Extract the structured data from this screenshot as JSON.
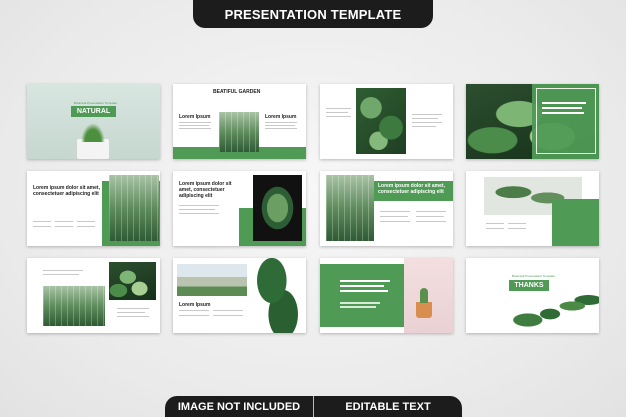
{
  "header": {
    "title": "PRESENTATION TEMPLATE"
  },
  "footer": {
    "left_label": "IMAGE NOT INCLUDED",
    "right_label": "EDITABLE TEXT"
  },
  "slides": {
    "s1": {
      "small": "Botanical Presentation Template",
      "label": "NATURAL"
    },
    "s2": {
      "title": "BEATIFUL GARDEN",
      "left_head": "Lorem Ipsum",
      "right_head": "Lorem Ipsum"
    },
    "s5": {
      "head": "Lorem ipsum dolor sit amet, consectetuer adipiscing elit"
    },
    "s6": {
      "head": "Lorem ipsum dolor sit amet, consectetuer adipiscing elit"
    },
    "s8": {
      "head": "Lorem ipsum dolor sit amet, consectetuer adipiscing elit"
    },
    "s12": {
      "small": "Botanical Presentation Template",
      "label": "THANKS"
    },
    "s13": {
      "head": "Lorem Ipsum"
    }
  },
  "colors": {
    "accent": "#4f9a55",
    "banner": "#1c1c1c"
  }
}
